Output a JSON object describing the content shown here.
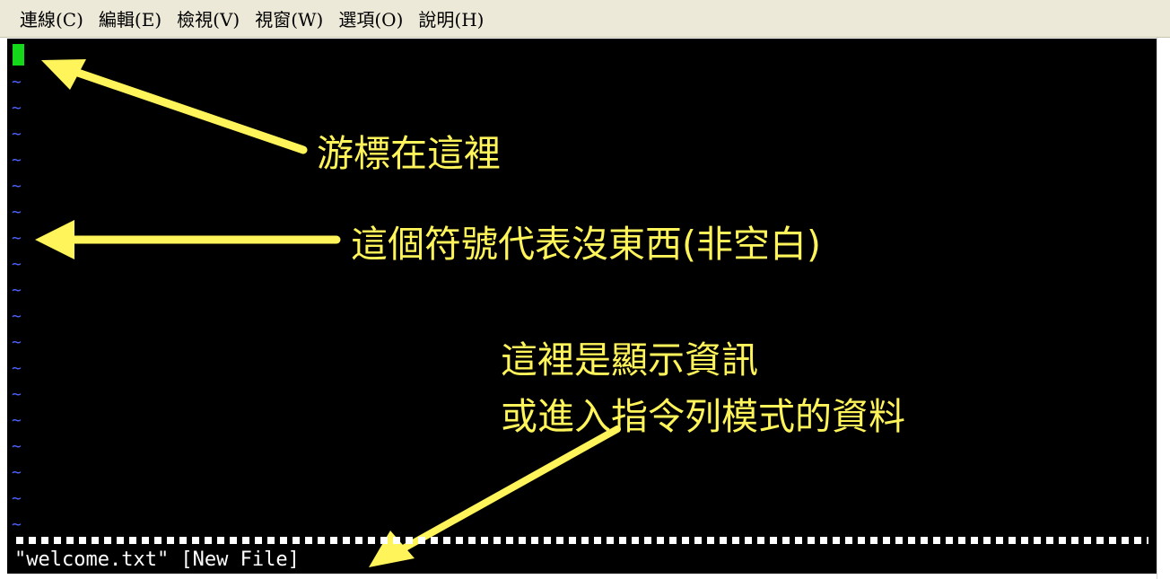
{
  "menu": {
    "items": [
      {
        "label": "連線(C)"
      },
      {
        "label": "編輯(E)"
      },
      {
        "label": "檢視(V)"
      },
      {
        "label": "視窗(W)"
      },
      {
        "label": "選項(O)"
      },
      {
        "label": "說明(H)"
      }
    ]
  },
  "terminal": {
    "empty_line_marker": "~",
    "status_line": "\"welcome.txt\" [New File]",
    "colors": {
      "background": "#000000",
      "cursor": "#16d81b",
      "tilde": "#4d63ff",
      "annotation": "#fff45a",
      "status_text": "#ffffff"
    }
  },
  "annotations": {
    "cursor_here": "游標在這裡",
    "empty_marker_meaning": "這個符號代表沒東西(非空白)",
    "info_line_1": "這裡是顯示資訊",
    "info_line_2": "或進入指令列模式的資料"
  }
}
